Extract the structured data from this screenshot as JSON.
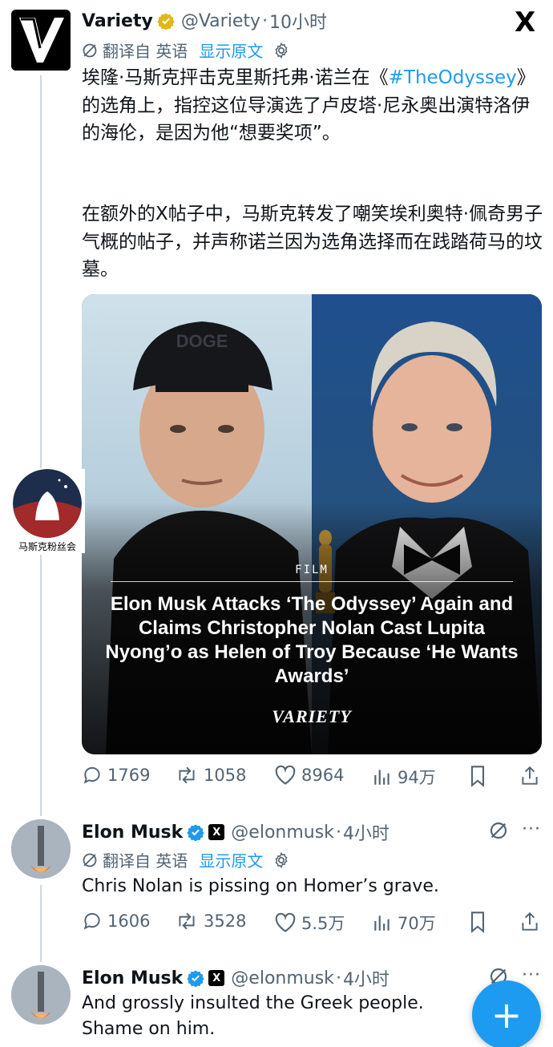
{
  "header": {
    "x_logo": "X"
  },
  "watermark": {
    "label": "马斯克粉丝会"
  },
  "tweets": [
    {
      "name": "Variety",
      "handle": "@Variety",
      "time": "10小时",
      "translate_label": "翻译自 英语",
      "show_original": "显示原文",
      "text_before_tag": "埃隆·马斯克抨击克里斯托弗·诺兰在《",
      "hashtag": "#TheOdyssey",
      "text_after_tag": "》的选角上，指控这位导演选了卢皮塔·尼永奥出演特洛伊的海伦，是因为他“想要奖项”。",
      "text_para2": "在额外的X帖子中，马斯克转发了嘲笑埃利奥特·佩奇男子气概的帖子，并声称诺兰因为选角选择而在践踏荷马的坟墓。",
      "media": {
        "tag": "FILM",
        "headline": "Elon Musk Attacks ‘The Odyssey’ Again and Claims Christopher Nolan Cast Lupita Nyong’o as Helen of Troy Because ‘He Wants Awards’",
        "brand": "VARIETY"
      },
      "stats": {
        "replies": "1769",
        "reposts": "1058",
        "likes": "8964",
        "views": "94万"
      }
    },
    {
      "name": "Elon Musk",
      "handle": "@elonmusk",
      "time": "4小时",
      "translate_label": "翻译自 英语",
      "show_original": "显示原文",
      "text": "Chris Nolan is pissing on Homer’s grave.",
      "stats": {
        "replies": "1606",
        "reposts": "3528",
        "likes": "5.5万",
        "views": "70万"
      }
    },
    {
      "name": "Elon Musk",
      "handle": "@elonmusk",
      "time": "4小时",
      "text": "And grossly insulted the Greek people. Shame on him."
    }
  ],
  "fab": {
    "label": "+"
  },
  "colors": {
    "accent": "#1d9bf0",
    "gold": "#e2b719",
    "muted": "#536471"
  }
}
